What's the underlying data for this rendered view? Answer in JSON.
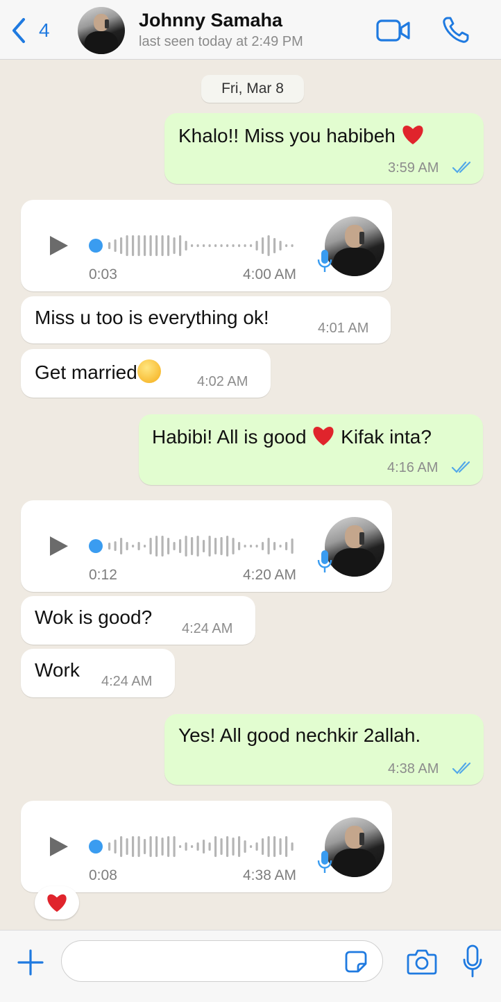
{
  "header": {
    "back_count": "4",
    "contact_name": "Johnny Samaha",
    "status": "last seen today at 2:49 PM"
  },
  "chat": {
    "date_separator": "Fri, Mar 8",
    "messages": [
      {
        "type": "text",
        "direction": "out",
        "text": "Khalo!! Miss you habibeh",
        "emoji": "red-heart",
        "time": "3:59 AM",
        "read": true
      },
      {
        "type": "voice",
        "direction": "in",
        "duration": "0:03",
        "time": "4:00 AM"
      },
      {
        "type": "text",
        "direction": "in",
        "text": "Miss u too is everything ok!",
        "time": "4:01 AM"
      },
      {
        "type": "text",
        "direction": "in",
        "text": "Get married",
        "emoji": "woozy-face",
        "time": "4:02 AM"
      },
      {
        "type": "text",
        "direction": "out",
        "text": "Habibi! All is good",
        "emoji": "red-heart",
        "text_after": "Kifak inta?",
        "time": "4:16 AM",
        "read": true
      },
      {
        "type": "voice",
        "direction": "in",
        "duration": "0:12",
        "time": "4:20 AM"
      },
      {
        "type": "text",
        "direction": "in",
        "text": "Wok is good?",
        "time": "4:24 AM"
      },
      {
        "type": "text",
        "direction": "in",
        "text": "Work",
        "time": "4:24 AM"
      },
      {
        "type": "text",
        "direction": "out",
        "text": "Yes! All good nechkir 2allah.",
        "time": "4:38 AM",
        "read": true
      },
      {
        "type": "voice",
        "direction": "in",
        "duration": "0:08",
        "time": "4:38 AM",
        "reaction": "red-heart"
      }
    ]
  },
  "input": {
    "placeholder": ""
  },
  "colors": {
    "accent": "#1f7ae0",
    "outgoing_bubble": "#e2fdd0",
    "incoming_bubble": "#ffffff",
    "chat_background": "#efeae2",
    "read_ticks": "#53a8e8"
  }
}
